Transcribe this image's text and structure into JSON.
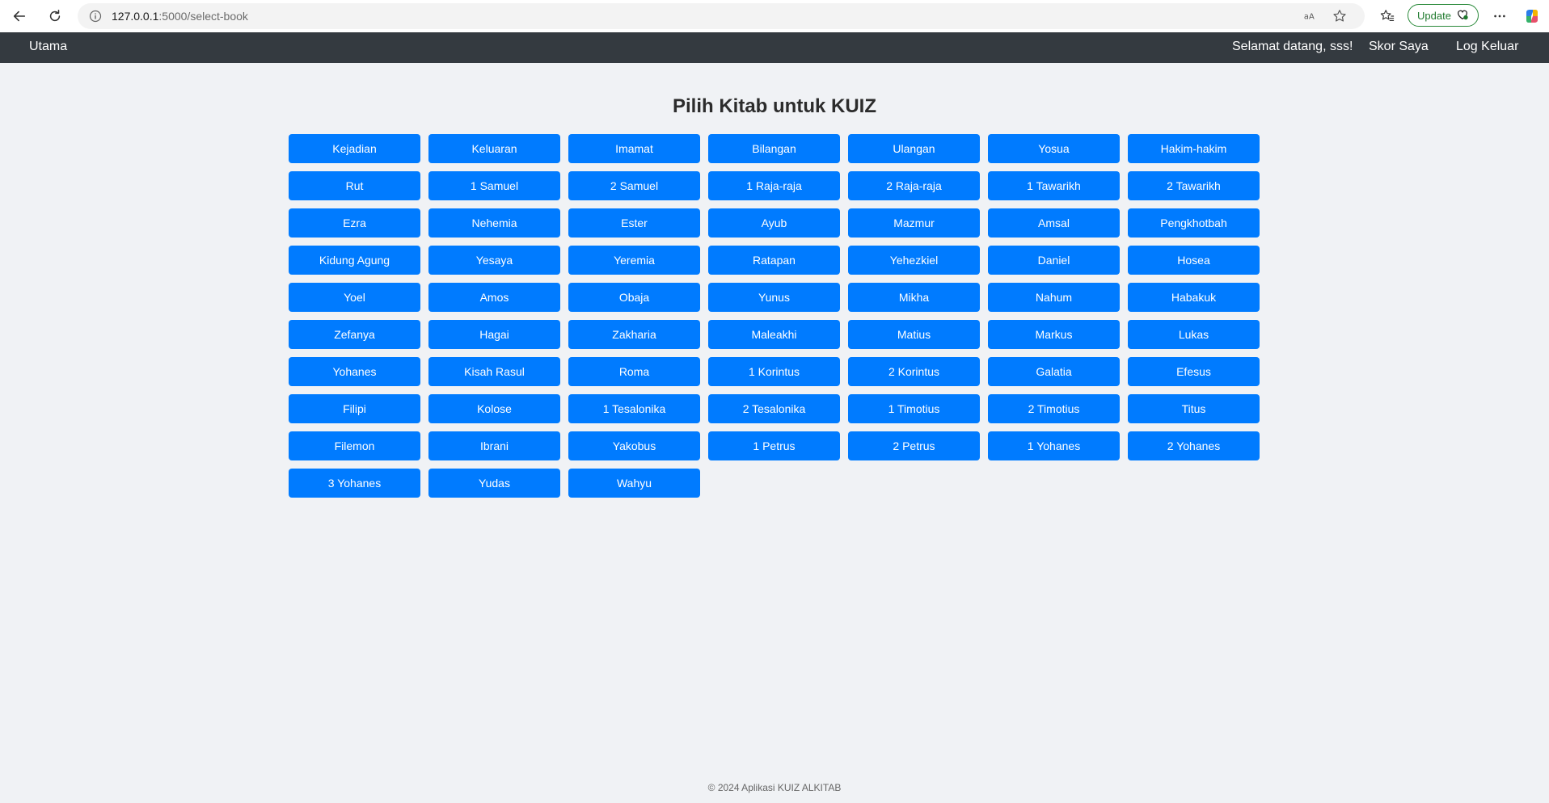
{
  "browser": {
    "url_host": "127.0.0.1",
    "url_path": ":5000/select-book",
    "update_label": "Update"
  },
  "navbar": {
    "home_label": "Utama",
    "welcome_text": "Selamat datang, sss!",
    "score_label": "Skor Saya",
    "logout_label": "Log Keluar"
  },
  "main": {
    "title": "Pilih Kitab untuk KUIZ",
    "books": [
      "Kejadian",
      "Keluaran",
      "Imamat",
      "Bilangan",
      "Ulangan",
      "Yosua",
      "Hakim-hakim",
      "Rut",
      "1 Samuel",
      "2 Samuel",
      "1 Raja-raja",
      "2 Raja-raja",
      "1 Tawarikh",
      "2 Tawarikh",
      "Ezra",
      "Nehemia",
      "Ester",
      "Ayub",
      "Mazmur",
      "Amsal",
      "Pengkhotbah",
      "Kidung Agung",
      "Yesaya",
      "Yeremia",
      "Ratapan",
      "Yehezkiel",
      "Daniel",
      "Hosea",
      "Yoel",
      "Amos",
      "Obaja",
      "Yunus",
      "Mikha",
      "Nahum",
      "Habakuk",
      "Zefanya",
      "Hagai",
      "Zakharia",
      "Maleakhi",
      "Matius",
      "Markus",
      "Lukas",
      "Yohanes",
      "Kisah Rasul",
      "Roma",
      "1 Korintus",
      "2 Korintus",
      "Galatia",
      "Efesus",
      "Filipi",
      "Kolose",
      "1 Tesalonika",
      "2 Tesalonika",
      "1 Timotius",
      "2 Timotius",
      "Titus",
      "Filemon",
      "Ibrani",
      "Yakobus",
      "1 Petrus",
      "2 Petrus",
      "1 Yohanes",
      "2 Yohanes",
      "3 Yohanes",
      "Yudas",
      "Wahyu"
    ]
  },
  "footer": {
    "text": "© 2024 Aplikasi KUIZ ALKITAB"
  },
  "colors": {
    "navbar_bg": "#343a40",
    "button_bg": "#007bff",
    "page_bg": "#f0f2f5"
  },
  "icons": {
    "back": "back-arrow-icon",
    "reload": "reload-icon",
    "info": "info-icon",
    "read_aloud": "read-aloud-icon",
    "favorite": "star-icon",
    "favorites_bar": "favorites-icon",
    "more": "more-icon",
    "copilot": "copilot-icon"
  }
}
